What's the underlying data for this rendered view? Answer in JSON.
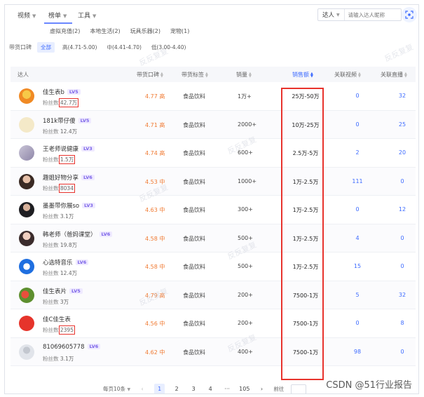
{
  "topbar": {
    "dropdowns": [
      "视频",
      "榜单",
      "工具"
    ],
    "search_select": "达人",
    "search_placeholder": "请输入达人昵称"
  },
  "categories": [
    "虚拟充值(2)",
    "本地生活(2)",
    "玩具乐器(2)",
    "宠物(1)"
  ],
  "tier_filter": {
    "label": "带货口碑",
    "options": [
      "全部",
      "高(4.71-5.00)",
      "中(4.41-4.70)",
      "低(3.00-4.40)"
    ],
    "active": 0
  },
  "table": {
    "headers": {
      "creator": "达人",
      "score": "带货口碑",
      "tag": "带货标签",
      "sales": "销量",
      "gmv": "销售额",
      "videos": "关联视频",
      "lives": "关联直播"
    },
    "fans_label": "粉丝数",
    "rows": [
      {
        "name": "佳生表b",
        "level": "LV5",
        "fans": "42.7万",
        "score": "4.77 高",
        "tag": "食品饮料",
        "sales": "1万+",
        "gmv": "25万-50万",
        "videos": "0",
        "lives": "32",
        "boxed": true
      },
      {
        "name": "181k带仔傻",
        "level": "LV5",
        "fans": "12.4万",
        "score": "4.71 高",
        "tag": "食品饮料",
        "sales": "2000+",
        "gmv": "10万-25万",
        "videos": "0",
        "lives": "25",
        "boxed": false
      },
      {
        "name": "王老师说健康",
        "level": "LV3",
        "fans": "1.5万",
        "score": "4.74 高",
        "tag": "食品饮料",
        "sales": "600+",
        "gmv": "2.5万-5万",
        "videos": "2",
        "lives": "20",
        "boxed": true
      },
      {
        "name": "趣姐好物分享",
        "level": "LV6",
        "fans": "8034",
        "score": "4.53 中",
        "tag": "食品饮料",
        "sales": "1000+",
        "gmv": "1万-2.5万",
        "videos": "111",
        "lives": "0",
        "boxed": true
      },
      {
        "name": "墨墨带你展so",
        "level": "LV3",
        "fans": "3.1万",
        "score": "4.63 中",
        "tag": "食品饮料",
        "sales": "300+",
        "gmv": "1万-2.5万",
        "videos": "0",
        "lives": "12",
        "boxed": false
      },
      {
        "name": "韩老师（爸妈课堂）",
        "level": "LV6",
        "fans": "19.8万",
        "score": "4.58 中",
        "tag": "食品饮料",
        "sales": "500+",
        "gmv": "1万-2.5万",
        "videos": "4",
        "lives": "0",
        "boxed": false
      },
      {
        "name": "心选特音乐",
        "level": "LV6",
        "fans": "12.4万",
        "score": "4.58 中",
        "tag": "食品饮料",
        "sales": "500+",
        "gmv": "1万-2.5万",
        "videos": "15",
        "lives": "0",
        "boxed": false
      },
      {
        "name": "佳生表片",
        "level": "LV5",
        "fans": "3万",
        "score": "4.79 高",
        "tag": "食品饮料",
        "sales": "200+",
        "gmv": "7500-1万",
        "videos": "5",
        "lives": "32",
        "boxed": false
      },
      {
        "name": "佳C佳生表",
        "level": "",
        "fans": "2395",
        "score": "4.56 中",
        "tag": "食品饮料",
        "sales": "200+",
        "gmv": "7500-1万",
        "videos": "0",
        "lives": "8",
        "boxed": true
      },
      {
        "name": "81069605778",
        "level": "LV6",
        "fans": "3.1万",
        "score": "4.62 中",
        "tag": "食品饮料",
        "sales": "400+",
        "gmv": "7500-1万",
        "videos": "98",
        "lives": "0",
        "boxed": false
      }
    ]
  },
  "pagination": {
    "per_page": "每页10条",
    "pages": [
      "1",
      "2",
      "3",
      "4",
      "···",
      "105"
    ],
    "active": 0,
    "jump_label": "前往"
  },
  "watermark_text": "反反复复",
  "footer_credit": "CSDN @51行业报告",
  "colors": {
    "accent": "#3d6bff",
    "highlight_box": "#e8332d",
    "score_orange": "#f07a32",
    "level_badge": "#7a62e8"
  }
}
